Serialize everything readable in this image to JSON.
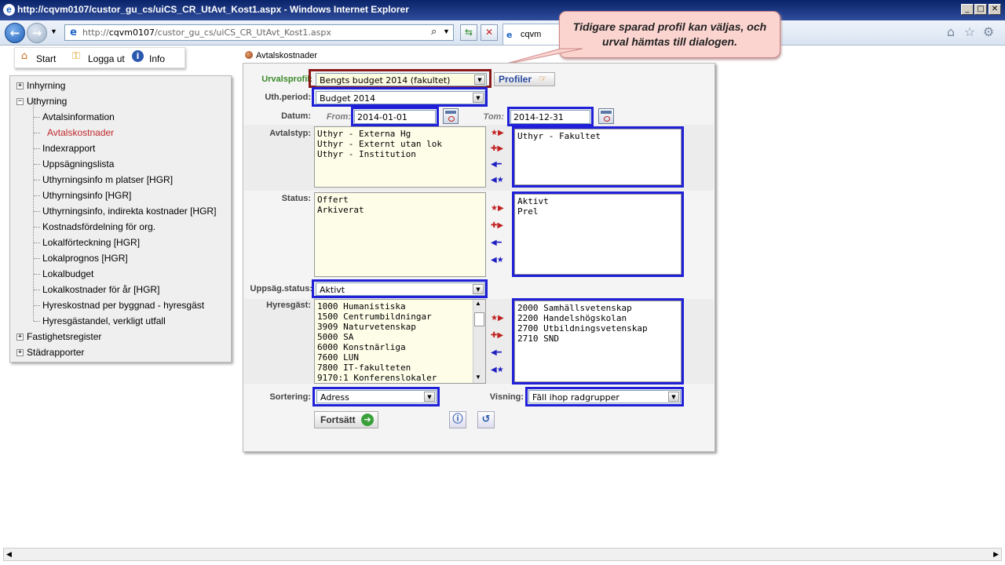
{
  "window": {
    "title": "http://cqvm0107/custor_gu_cs/uiCS_CR_UtAvt_Kost1.aspx - Windows Internet Explorer"
  },
  "browser": {
    "url_prefix": "http://",
    "url_host": "cqvm0107",
    "url_path": "/custor_gu_cs/uiCS_CR_UtAvt_Kost1.aspx",
    "tab_label": "cqvm"
  },
  "callout": {
    "text": "Tidigare sparad profil kan väljas, och urval hämtas till dialogen."
  },
  "topnav": {
    "start": "Start",
    "logout": "Logga ut",
    "info": "Info"
  },
  "tree": {
    "inhyrning": "Inhyrning",
    "uthyrning": "Uthyrning",
    "children": [
      "Avtalsinformation",
      "Avtalskostnader",
      "Indexrapport",
      "Uppsägningslista",
      "Uthyrningsinfo m platser [HGR]",
      "Uthyrningsinfo [HGR]",
      "Uthyrningsinfo, indirekta kostnader [HGR]",
      "Kostnadsfördelning för org.",
      "Lokalförteckning [HGR]",
      "Lokalprognos [HGR]",
      "Lokalbudget",
      "Lokalkostnader för år [HGR]",
      "Hyreskostnad per byggnad - hyresgäst",
      "Hyresgästandel, verkligt utfall"
    ],
    "fastighetsregister": "Fastighetsregister",
    "stadrapporter": "Städrapporter"
  },
  "breadcrumb": "Avtalskostnader",
  "form": {
    "urvalsprofil_label": "Urvalsprofil:",
    "urvalsprofil_value": "Bengts budget 2014 (fakultet)",
    "profiler_button": "Profiler",
    "uthperiod_label": "Uth.period:",
    "uthperiod_value": "Budget 2014",
    "datum_label": "Datum:",
    "from_label": "From:",
    "from_value": "2014-01-01",
    "tom_label": "Tom:",
    "tom_value": "2014-12-31",
    "avtalstyp_label": "Avtalstyp:",
    "avtalstyp_available": [
      "Uthyr - Externa Hg",
      "Uthyr - Externt utan lok",
      "Uthyr - Institution"
    ],
    "avtalstyp_selected": [
      "Uthyr - Fakultet"
    ],
    "status_label": "Status:",
    "status_available": [
      "Offert",
      "Arkiverat"
    ],
    "status_selected": [
      "Aktivt",
      "Prel"
    ],
    "uppsag_label": "Uppsäg.status:",
    "uppsag_value": "Aktivt",
    "hyresgast_label": "Hyresgäst:",
    "hyresgast_available": [
      "1000 Humanistiska",
      "1500 Centrumbildningar",
      "3909 Naturvetenskap",
      "5000 SA",
      "6000 Konstnärliga",
      "7600 LUN",
      "7800 IT-fakulteten",
      "9170:1 Konferenslokaler"
    ],
    "hyresgast_selected": [
      "2000 Samhällsvetenskap",
      "2200 Handelshögskolan",
      "2700 Utbildningsvetenskap",
      "2710 SND"
    ],
    "sortering_label": "Sortering:",
    "sortering_value": "Adress",
    "visning_label": "Visning:",
    "visning_value": "Fäll ihop radgrupper",
    "fortsatt_button": "Fortsätt"
  },
  "colors": {
    "highlight_blue": "#2020d8",
    "highlight_red": "#8a1a1a",
    "active_link": "#c0282d",
    "callout_bg": "#fbd4d0"
  }
}
